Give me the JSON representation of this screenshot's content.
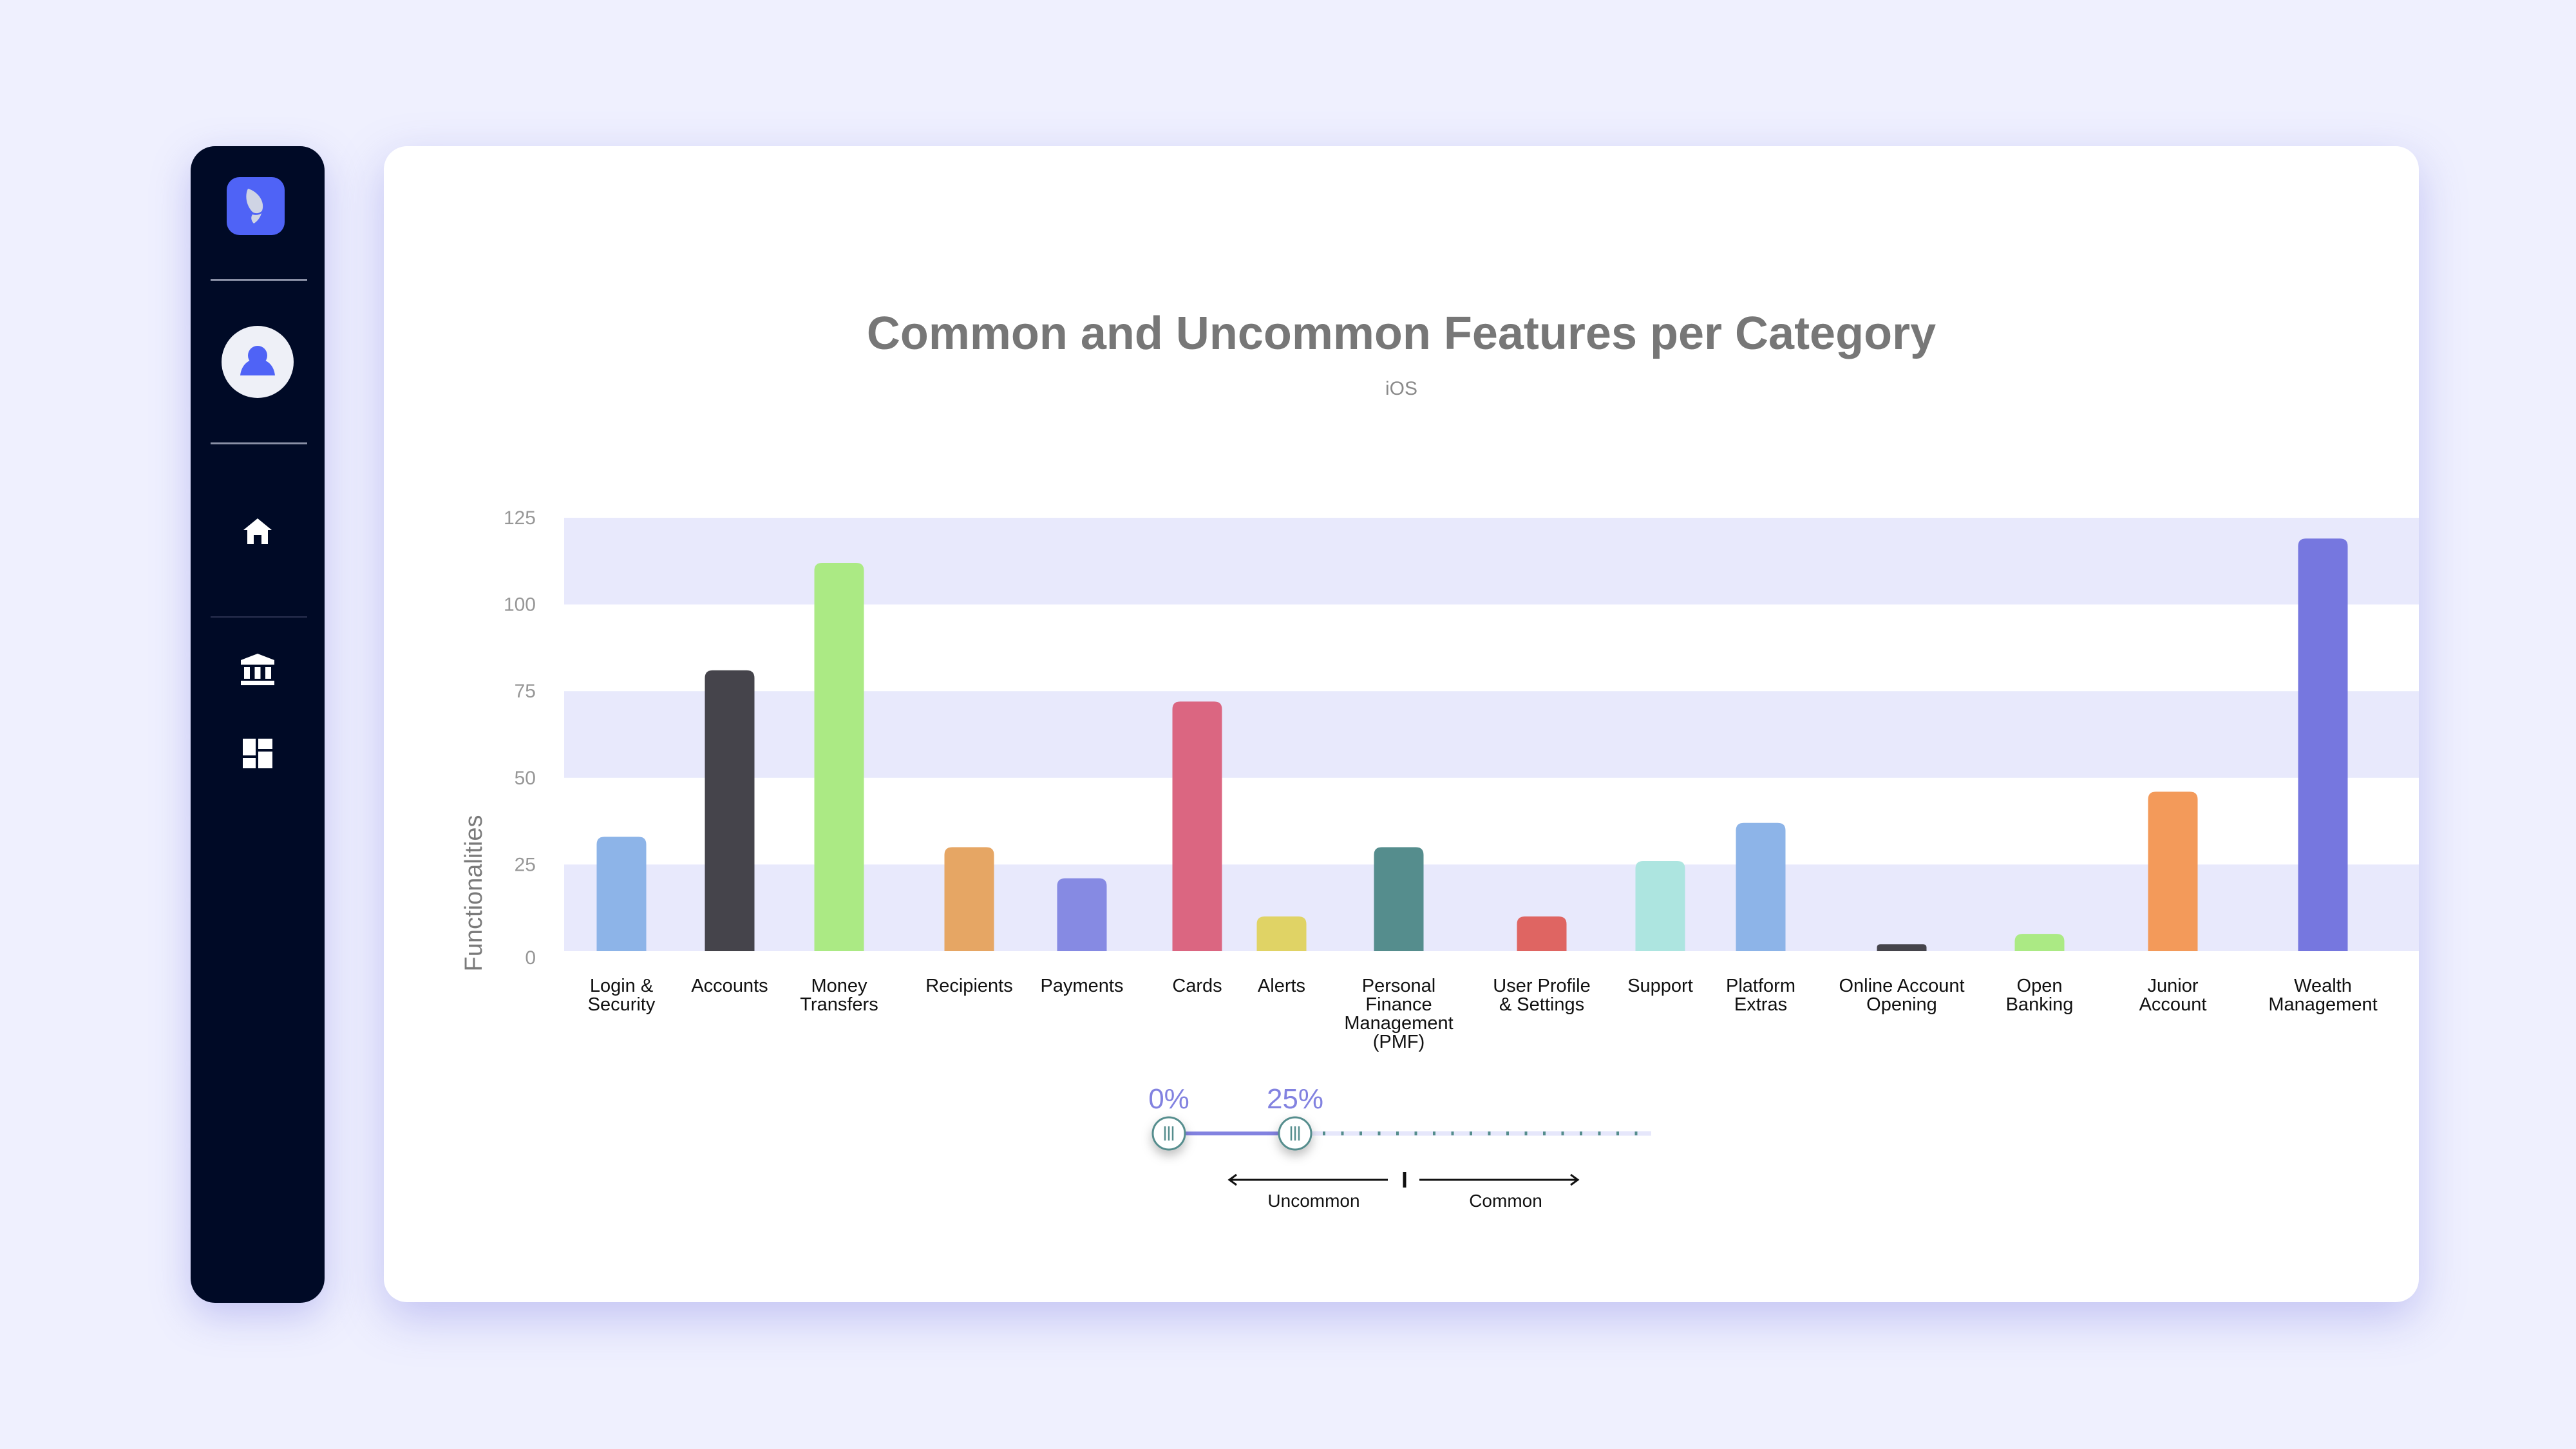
{
  "sidebar": {
    "logo": "brand-logo",
    "avatar": "user-avatar",
    "items": [
      {
        "name": "home",
        "icon": "home-icon"
      },
      {
        "name": "bank",
        "icon": "bank-icon"
      },
      {
        "name": "dashboard",
        "icon": "dashboard-icon"
      }
    ],
    "colors": {
      "background": "#000a26",
      "accent": "#4f63f6"
    }
  },
  "chart_data": {
    "type": "bar",
    "title": "Common and Uncommon Features per Category",
    "subtitle": "iOS",
    "xlabel": "",
    "ylabel": "Functionalities",
    "ylim": [
      0,
      125
    ],
    "yticks": [
      0,
      25,
      50,
      75,
      100,
      125
    ],
    "grid": "alternating horizontal bands",
    "legend": "none",
    "categories": [
      {
        "label": [
          "Login &",
          "Security"
        ],
        "value": 33,
        "color": "#8db4e8"
      },
      {
        "label": [
          "Accounts"
        ],
        "value": 81,
        "color": "#45444b"
      },
      {
        "label": [
          "Money",
          "Transfers"
        ],
        "value": 112,
        "color": "#abea84"
      },
      {
        "label": [
          "Recipients"
        ],
        "value": 30,
        "color": "#e6a664"
      },
      {
        "label": [
          "Payments"
        ],
        "value": 21,
        "color": "#868ae3"
      },
      {
        "label": [
          "Cards"
        ],
        "value": 72,
        "color": "#db6681"
      },
      {
        "label": [
          "Alerts"
        ],
        "value": 10,
        "color": "#e0d365"
      },
      {
        "label": [
          "Personal",
          "Finance",
          "Management",
          "(PMF)"
        ],
        "value": 30,
        "color": "#558d8d"
      },
      {
        "label": [
          "User Profile",
          "& Settings"
        ],
        "value": 10,
        "color": "#df6562"
      },
      {
        "label": [
          "Support"
        ],
        "value": 26,
        "color": "#ade5e0"
      },
      {
        "label": [
          "Platform",
          "Extras"
        ],
        "value": 37,
        "color": "#8db4e8"
      },
      {
        "label": [
          "Online Account",
          "Opening"
        ],
        "value": 2,
        "color": "#45444b"
      },
      {
        "label": [
          "Open",
          "Banking"
        ],
        "value": 5,
        "color": "#abea84"
      },
      {
        "label": [
          "Junior",
          "Account"
        ],
        "value": 46,
        "color": "#f39a5a"
      },
      {
        "label": [
          "Wealth",
          "Management"
        ],
        "value": 119,
        "color": "#7677df"
      }
    ]
  },
  "slider": {
    "min_label": "0%",
    "max_label": "25%",
    "min_value": 0,
    "max_value": 25,
    "range_max": 100,
    "accent": "#8282e0",
    "left_caption": "Uncommon",
    "right_caption": "Common"
  }
}
